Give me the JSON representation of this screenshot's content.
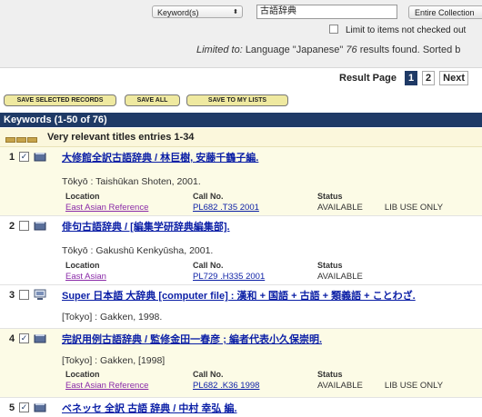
{
  "search": {
    "field_selector": "Keyword(s)",
    "query": "古語辞典",
    "scope_button": "Entire Collection",
    "limit_checkbox_label": "Limit to items not checked out"
  },
  "summary": {
    "limited_to_label": "Limited to:",
    "limited_to_value": "Language \"Japanese\"",
    "count": "76",
    "count_suffix": "results found.",
    "sorted_text": "Sorted b"
  },
  "pager": {
    "label": "Result Page",
    "current": "1",
    "page2": "2",
    "next": "Next"
  },
  "toolbar": {
    "save_selected": "SAVE SELECTED RECORDS",
    "save_all": "SAVE ALL",
    "save_lists": "SAVE TO MY LISTS"
  },
  "results_header": "Keywords (1-50 of 76)",
  "relevance": {
    "label": "Very relevant titles entries 1-34",
    "level": 3
  },
  "columns": {
    "location": "Location",
    "call_no": "Call No.",
    "status": "Status"
  },
  "records": [
    {
      "num": "1",
      "checked": true,
      "icon": "book-icon",
      "title": "大修館全訳古語辞典 / 林巨樹, 安藤千鶴子編.",
      "imprint": "Tōkyō : Taishūkan Shoten, 2001.",
      "location": "East Asian Reference",
      "call_no": "PL682 .T35 2001",
      "status": "AVAILABLE",
      "status_note": "LIB USE ONLY"
    },
    {
      "num": "2",
      "checked": false,
      "icon": "book-icon",
      "title": "俳句古語辞典 / [編集学研辞典編集部].",
      "imprint": "Tōkyō : Gakushū Kenkyūsha, 2001.",
      "location": "East Asian",
      "call_no": "PL729 .H335 2001",
      "status": "AVAILABLE",
      "status_note": ""
    },
    {
      "num": "3",
      "checked": false,
      "icon": "computer-file-icon",
      "title": "Super 日本語 大辞典 [computer file] : 漢和 + 国語 + 古語 + 類義語 + ことわざ.",
      "imprint": "[Tokyo] : Gakken, 1998."
    },
    {
      "num": "4",
      "checked": true,
      "icon": "book-icon",
      "title": "完訳用例古語辞典 / 監修金田一春彦 ; 編者代表小久保崇明.",
      "imprint": "[Tokyo] : Gakken, [1998]",
      "location": "East Asian Reference",
      "call_no": "PL682 .K36 1998",
      "status": "AVAILABLE",
      "status_note": "LIB USE ONLY"
    },
    {
      "num": "5",
      "checked": true,
      "icon": "book-icon",
      "title": "ベネッセ 全訳 古語 辞典 / 中村 幸弘 編."
    }
  ],
  "colors": {
    "header_blue": "#1f3a66",
    "link_blue": "#0b1fa6",
    "location_purple": "#8a2aa8",
    "highlight": "#fcfbe6",
    "button_yellow": "#efe9a0"
  }
}
